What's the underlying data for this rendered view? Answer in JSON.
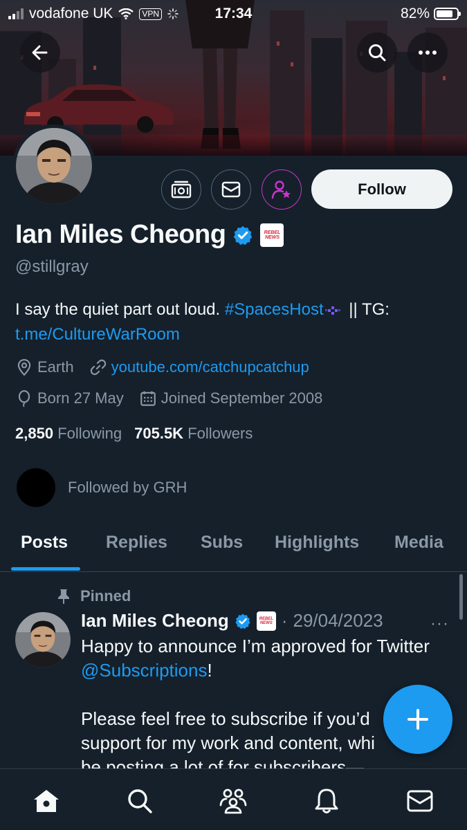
{
  "status_bar": {
    "carrier": "vodafone UK",
    "vpn": "VPN",
    "time": "17:34",
    "battery": "82%",
    "battery_level": 0.82
  },
  "banner": {
    "back_icon": "arrow-left-icon",
    "search_icon": "search-icon",
    "more_icon": "more-horizontal-icon"
  },
  "profile": {
    "display_name": "Ian Miles Cheong",
    "handle": "@stillgray",
    "affiliate_badge": "REBEL NEWS",
    "bio_text": "I say the quiet part out loud. ",
    "bio_hashtag": "#SpacesHost",
    "bio_after": " || TG:",
    "bio_link": "t.me/CultureWarRoom",
    "location": "Earth",
    "website": "youtube.com/catchupcatchup",
    "born": "Born 27 May",
    "joined": "Joined September 2008",
    "following_count": "2,850",
    "following_label": "Following",
    "followers_count": "705.5K",
    "followers_label": "Followers",
    "followed_by": "Followed by GRH",
    "follow_button": "Follow"
  },
  "tabs": [
    {
      "label": "Posts",
      "active": true
    },
    {
      "label": "Replies",
      "active": false
    },
    {
      "label": "Subs",
      "active": false
    },
    {
      "label": "Highlights",
      "active": false
    },
    {
      "label": "Media",
      "active": false
    }
  ],
  "pinned_post": {
    "pinned_label": "Pinned",
    "author": "Ian Miles Cheong",
    "separator": "·",
    "date": "29/04/2023",
    "more": "···",
    "line1": "Happy to announce I’m approved for Twitter",
    "mention": "@Subscriptions",
    "mention_after": "!",
    "para2_line1": "Please feel free to subscribe if you’d",
    "para2_line2": "support for my work and content, whi",
    "para2_line3": "be posting a lot of for subscribers—"
  },
  "colors": {
    "background": "#15202b",
    "accent": "#1d9bf0",
    "muted": "#8b98a5",
    "subscribe_ring": "#c936cc"
  },
  "bottom_nav": [
    "home-icon",
    "search-icon",
    "communities-icon",
    "notifications-icon",
    "messages-icon"
  ]
}
